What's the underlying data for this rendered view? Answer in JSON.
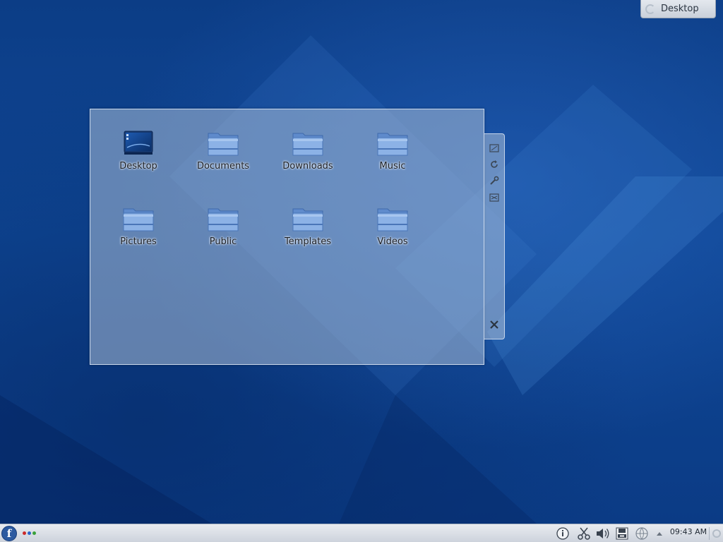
{
  "desktop_toolbox": {
    "label": "Desktop"
  },
  "folder_view": {
    "items": [
      {
        "label": "Desktop",
        "icon": "desktop-folder-icon"
      },
      {
        "label": "Documents",
        "icon": "folder-icon"
      },
      {
        "label": "Downloads",
        "icon": "folder-icon"
      },
      {
        "label": "Music",
        "icon": "folder-icon"
      },
      {
        "label": "Pictures",
        "icon": "folder-icon"
      },
      {
        "label": "Public",
        "icon": "folder-icon"
      },
      {
        "label": "Templates",
        "icon": "folder-icon"
      },
      {
        "label": "Videos",
        "icon": "folder-icon"
      }
    ]
  },
  "applet_handle": {
    "buttons": [
      "resize-icon",
      "rotate-icon",
      "wrench-icon",
      "maximize-icon",
      "close-icon"
    ]
  },
  "taskbar": {
    "clock": "09:43 AM",
    "pager_colors": [
      "#cc2a2a",
      "#2a66cc",
      "#3aa13a"
    ],
    "tray_icons": [
      "notifications-icon",
      "clipboard-scissors-icon",
      "volume-icon",
      "printer-icon",
      "network-icon",
      "expand-tray-arrow-icon"
    ]
  },
  "colors": {
    "wallpaper": "#0d3f8a",
    "widget_bg": "#aabed7",
    "folder_blue": "#6d98d6"
  }
}
